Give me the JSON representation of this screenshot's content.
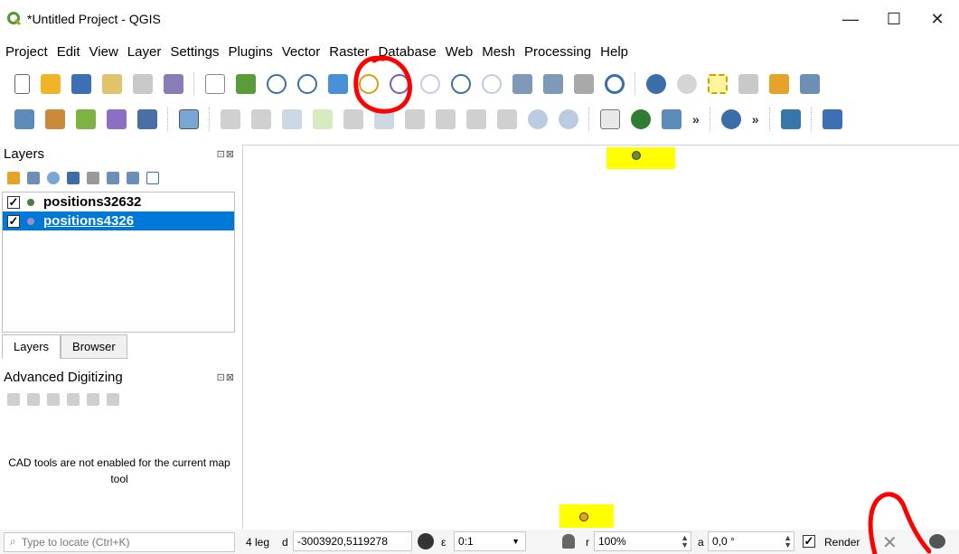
{
  "window": {
    "title": "*Untitled Project - QGIS",
    "minimize": "—",
    "maximize": "☐",
    "close": "✕"
  },
  "menu": [
    "Project",
    "Edit",
    "View",
    "Layer",
    "Settings",
    "Plugins",
    "Vector",
    "Raster",
    "Database",
    "Web",
    "Mesh",
    "Processing",
    "Help"
  ],
  "layers_panel": {
    "title": "Layers",
    "float_close": "⊡⊠",
    "layers": [
      {
        "name": "positions32632",
        "checked": "✓",
        "dot_color": "#4a7d3c",
        "selected": false
      },
      {
        "name": "positions4326",
        "checked": "✓",
        "dot_color": "#9b8fc7",
        "selected": true
      }
    ]
  },
  "tabs": [
    "Layers",
    "Browser"
  ],
  "advanced_digitizing": {
    "title": "Advanced Digitizing",
    "float_close": "⊡⊠",
    "message": "CAD tools are not enabled for the current map tool"
  },
  "map": {
    "points": [
      {
        "color": "#6b8e23"
      },
      {
        "color": "#e8a317"
      }
    ],
    "highlight_color": "#ffff00"
  },
  "statusbar": {
    "locate_placeholder": "Type to locate (Ctrl+K)",
    "legend_text": "4 leg",
    "coordinate_label": "d",
    "coordinate": "-3003920,5119278",
    "scale_label": "ε",
    "scale": "0:1",
    "magnifier_label": "r",
    "magnifier": "100%",
    "rotation_label": "a",
    "rotation": "0,0 °",
    "render_checked": "✓",
    "render_label": "Render"
  },
  "colors": {
    "selection_blue": "#0078d7",
    "annotation_red": "#ff0000"
  }
}
